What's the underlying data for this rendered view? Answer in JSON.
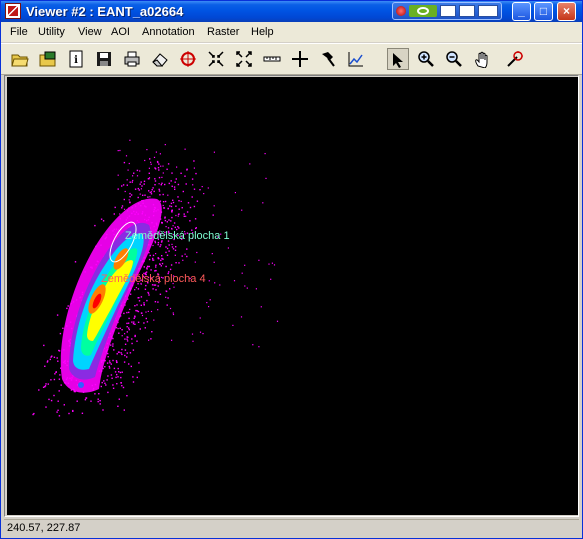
{
  "window": {
    "title": "Viewer #2 : EANT_a02664",
    "minimize_glyph": "_",
    "maximize_glyph": "□",
    "close_glyph": "×"
  },
  "menu": [
    "File",
    "Utility",
    "View",
    "AOI",
    "Annotation",
    "Raster",
    "Help"
  ],
  "toolbar": [
    "open-folder-icon",
    "open-raster-icon",
    "info-icon",
    "save-icon",
    "print-icon",
    "eraser-icon",
    "inquire-cursor-icon",
    "fit-inward-icon",
    "fit-outward-icon",
    "measure-icon",
    "crosshair-icon",
    "tool-palette-icon",
    "profile-icon",
    "select-pointer-icon",
    "zoom-in-icon",
    "zoom-out-icon",
    "pan-hand-icon",
    "magnifier-wand-icon"
  ],
  "aoi_labels": [
    {
      "text": "Zemědělská plocha 1",
      "color": "#7fffd4"
    },
    {
      "text": "Zemědělská plocha 4",
      "color": "#ff5a5a"
    }
  ],
  "status": {
    "coordinates": "240.57, 227.87"
  },
  "colors": {
    "titlebar": "#0054e3",
    "canvas": "#000000",
    "scatter_sparse": "#ff00ff",
    "scatter_dense": [
      "#00d4ff",
      "#00ffa0",
      "#ffff00",
      "#ff8000",
      "#ff0000"
    ]
  }
}
